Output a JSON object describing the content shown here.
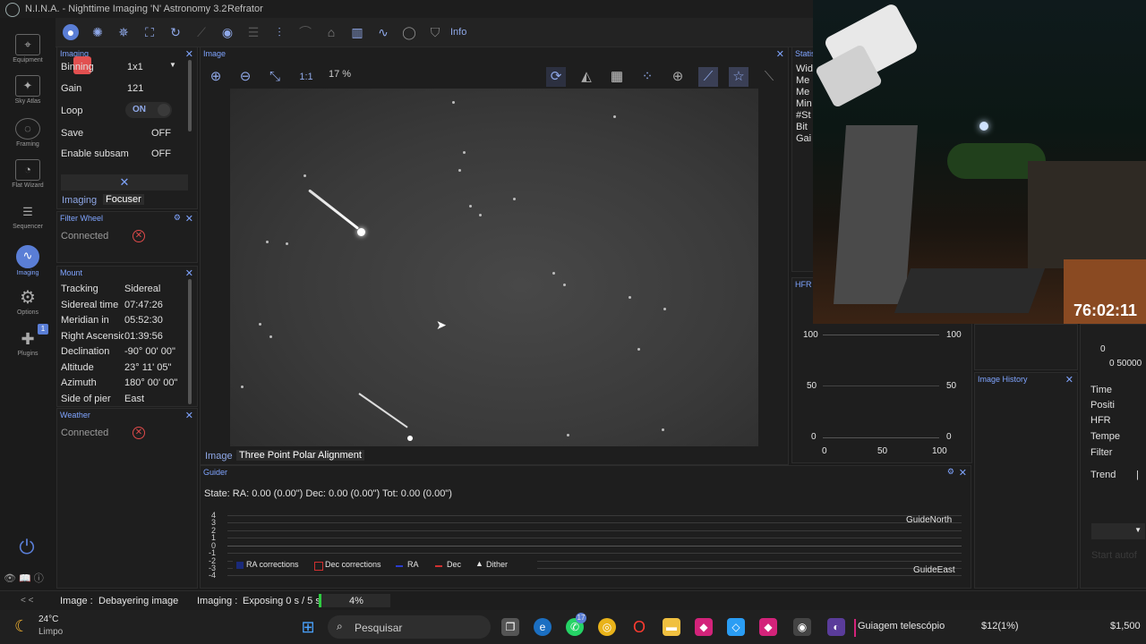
{
  "window": {
    "title": "N.I.N.A. - Nighttime Imaging 'N' Astronomy 3.2",
    "profile": "Refrator"
  },
  "nav": [
    {
      "label": "Equipment",
      "icon": "telescope-icon"
    },
    {
      "label": "Sky Atlas",
      "icon": "star-map-icon"
    },
    {
      "label": "Framing",
      "icon": "framing-icon"
    },
    {
      "label": "Flat Wizard",
      "icon": "flat-wizard-icon"
    },
    {
      "label": "Sequencer",
      "icon": "sequencer-icon"
    },
    {
      "label": "Imaging",
      "icon": "imaging-icon"
    },
    {
      "label": "Options",
      "icon": "gear-icon"
    },
    {
      "label": "Plugins",
      "icon": "puzzle-icon",
      "badge": "1"
    }
  ],
  "toolbar": {
    "info_label": "Info"
  },
  "imaging_panel": {
    "title": "Imaging",
    "rows": [
      {
        "label": "Binning",
        "value": "1x1"
      },
      {
        "label": "Gain",
        "value": "121"
      },
      {
        "label": "Loop",
        "value": "ON"
      },
      {
        "label": "Save",
        "value": "OFF"
      },
      {
        "label": "Enable subsam",
        "value": "OFF"
      }
    ],
    "tabs": [
      "Imaging",
      "Focuser"
    ]
  },
  "filter_wheel": {
    "title": "Filter Wheel",
    "status": "Connected"
  },
  "mount": {
    "title": "Mount",
    "rows": [
      {
        "label": "Tracking",
        "value": "Sidereal"
      },
      {
        "label": "Sidereal time",
        "value": "07:47:26"
      },
      {
        "label": "Meridian in",
        "value": "05:52:30"
      },
      {
        "label": "Right Ascension",
        "value": "01:39:56"
      },
      {
        "label": "Declination",
        "value": "-90° 00' 00\""
      },
      {
        "label": "Altitude",
        "value": "23° 11' 05\""
      },
      {
        "label": "Azimuth",
        "value": "180° 00' 00\""
      },
      {
        "label": "Side of pier",
        "value": "East"
      }
    ]
  },
  "weather": {
    "title": "Weather",
    "status": "Connected"
  },
  "image_panel": {
    "title": "Image",
    "zoom_label": "1:1",
    "zoom_percent": "17 %",
    "tabs": [
      "Image",
      "Three Point Polar Alignment"
    ]
  },
  "statistics": {
    "title": "Statistics",
    "rows": [
      "Wid",
      "Me",
      "Me",
      "Min",
      "#St",
      "Bit",
      "Gai"
    ]
  },
  "hfr": {
    "title": "HFR h",
    "y_left": [
      "100",
      "50",
      "0"
    ],
    "y_right": [
      "100",
      "50",
      "0"
    ],
    "x": [
      "0",
      "50",
      "100"
    ]
  },
  "image_history": {
    "title": "Image History"
  },
  "right_panel": {
    "rows": [
      "Time",
      "Positi",
      "HFR",
      "Tempe",
      "Filter",
      "Trend"
    ],
    "axis_left": "0",
    "axis_right": "0 50000",
    "start_label": "Start autof"
  },
  "camera": {
    "timer": "76:02:11"
  },
  "guider": {
    "title": "Guider",
    "state": "State:  RA: 0.00 (0.00\")  Dec: 0.00 (0.00\")  Tot: 0.00 (0.00\")",
    "y_ticks": [
      "4",
      "3",
      "2",
      "1",
      "0",
      "-1",
      "-2",
      "-3",
      "-4"
    ],
    "guide_north": "GuideNorth",
    "guide_east": "GuideEast",
    "legend": [
      "RA corrections",
      "Dec corrections",
      "RA",
      "Dec",
      "Dither"
    ],
    "colors": {
      "ra": "#2a3ccf",
      "dec": "#d03030"
    }
  },
  "statusbar": {
    "collapse": "< <",
    "image_label": "Image :",
    "image_status": "Debayering image",
    "imaging_label": "Imaging :",
    "imaging_status": "Exposing 0 s / 5 s",
    "progress_text": "4%",
    "progress": 0.04
  },
  "taskbar": {
    "temp": "24°C",
    "weather": "Limpo",
    "search_placeholder": "Pesquisar",
    "edge_badge": "17",
    "app_title": "Guiagem telescópio",
    "ticker1": "$12(1%)",
    "ticker2": "$1,500"
  }
}
